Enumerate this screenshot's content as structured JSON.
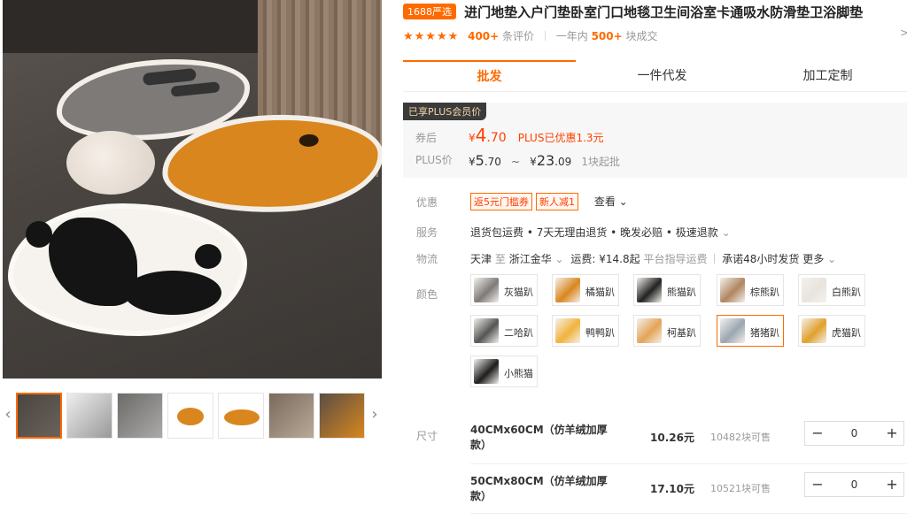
{
  "gallery": {
    "thumbnails": [
      "灰猫+熊猫",
      "熊猫",
      "灰猫",
      "柯基",
      "橘猫",
      "灰猫2",
      "柯基2"
    ]
  },
  "product": {
    "badge": "1688严选",
    "title": "进门地垫入户门垫卧室门口地毯卫生间浴室卡通吸水防滑垫卫浴脚垫",
    "stars": "★★★★★",
    "review_count": "400+",
    "review_label": "条评价",
    "sold_prefix": "一年内",
    "sold_count": "500+",
    "sold_label": "块成交",
    "more_icon": ">"
  },
  "tabs": [
    {
      "label": "批发",
      "active": true
    },
    {
      "label": "一件代发",
      "active": false
    },
    {
      "label": "加工定制",
      "active": false
    }
  ],
  "price": {
    "plus_tag": "已享PLUS会员价",
    "after_coupon_label": "券后",
    "yen": "¥",
    "after_coupon_int": "4",
    "after_coupon_dec": ".70",
    "plus_discount_note": "PLUS已优惠1.3元",
    "plus_label": "PLUS价",
    "plus_low_int": "5",
    "plus_low_dec": ".70",
    "plus_high_int": "23",
    "plus_high_dec": ".09",
    "tilde": "~",
    "min_order": "1块起批"
  },
  "offers": {
    "label": "优惠",
    "coupons": [
      "返5元门槛券",
      "新人减1"
    ],
    "look": "查看"
  },
  "service": {
    "label": "服务",
    "text": "退货包运费 • 7天无理由退货 • 晚发必赔 • 极速退款"
  },
  "logistics": {
    "label": "物流",
    "from": "天津",
    "to_word": "至",
    "to": "浙江金华",
    "freight_label": "运费: ¥14.8起",
    "freight_note": "平台指导运费",
    "promise": "承诺48小时发货",
    "more": "更多"
  },
  "colors": {
    "label": "颜色",
    "options": [
      {
        "label": "灰猫趴",
        "color": "#7d7a78"
      },
      {
        "label": "橘猫趴",
        "color": "#d9861e"
      },
      {
        "label": "熊猫趴",
        "color": "#222222"
      },
      {
        "label": "棕熊趴",
        "color": "#b08561"
      },
      {
        "label": "白熊趴",
        "color": "#e8e4dd"
      },
      {
        "label": "二哈趴",
        "color": "#555555"
      },
      {
        "label": "鸭鸭趴",
        "color": "#f2b33d"
      },
      {
        "label": "柯基趴",
        "color": "#e3a457"
      },
      {
        "label": "猪猪趴",
        "color": "#9aa6b2"
      },
      {
        "label": "虎猫趴",
        "color": "#e0a02b"
      },
      {
        "label": "小熊猫",
        "color": "#1d1d1d"
      }
    ],
    "selected": "猪猪趴"
  },
  "sizes": {
    "label": "尺寸",
    "rows": [
      {
        "name": "40CMx60CM（仿羊绒加厚款）",
        "price": "10.26元",
        "stock": "10482块可售",
        "qty": "0"
      },
      {
        "name": "50CMx80CM（仿羊绒加厚款）",
        "price": "17.10元",
        "stock": "10521块可售",
        "qty": "0"
      }
    ],
    "minus": "−",
    "plus": "+"
  },
  "accent": "#ff6a00"
}
